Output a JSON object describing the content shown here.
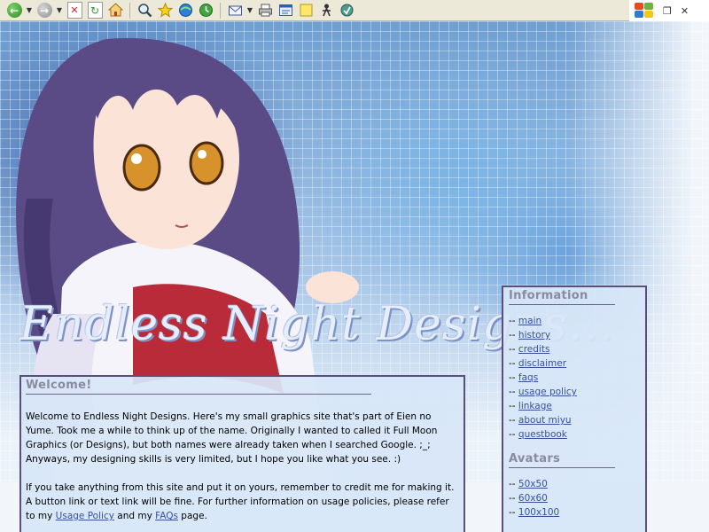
{
  "toolbar": {
    "icons": [
      "back-icon",
      "forward-icon",
      "stop-icon",
      "refresh-icon",
      "home-icon",
      "search-icon",
      "favorites-icon",
      "media-icon",
      "history-icon",
      "mail-icon",
      "print-icon",
      "edit-icon",
      "discuss-icon",
      "messenger-icon",
      "extra-icon"
    ]
  },
  "site": {
    "title": "Endless Night Designs..."
  },
  "welcome": {
    "heading": "Welcome!",
    "p1": "Welcome to Endless Night Designs. Here's my small graphics site that's part of Eien no Yume. Took me a while to think up of the name. Originally I wanted to called it Full Moon Graphics (or Designs), but both names were already taken when I searched Google. ;_; Anyways, my designing skills is very limited, but I hope you like what you see. :)",
    "p2_before": "If you take anything from this site and put it on yours, remember to credit me for making it. A button link or text link will be fine. For further information on usage policies, please refer to my ",
    "p2_link1": "Usage Policy",
    "p2_mid": " and my ",
    "p2_link2": "FAQs",
    "p2_after": " page."
  },
  "info": {
    "heading": "Information",
    "prefix": "-- ",
    "links": [
      "main",
      "history",
      "credits",
      "disclaimer",
      "faqs",
      "usage policy",
      "linkage",
      "about miyu",
      "questbook"
    ],
    "avatars_heading": "Avatars",
    "avatar_links": [
      "50x50",
      "60x60",
      "100x100"
    ]
  },
  "colors": {
    "box_border": "#58507a",
    "box_bg": "#d7e6f7",
    "heading": "#8a8aa0",
    "link": "#3552a0"
  }
}
